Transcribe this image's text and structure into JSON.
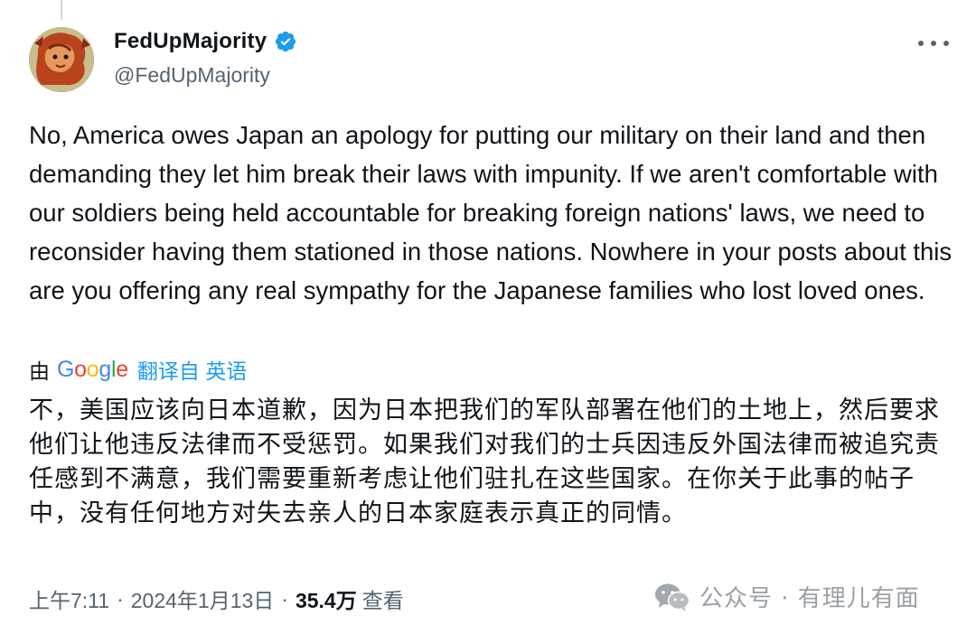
{
  "tweet": {
    "author": {
      "display_name": "FedUpMajority",
      "handle": "@FedUpMajority",
      "verified": true
    },
    "text": "No, America owes Japan an apology for putting our military on their land and then demanding they let him break their laws with impunity. If we aren't comfortable with our soldiers being held accountable for breaking foreign nations' laws, we need to reconsider having them stationed in those nations. Nowhere in your posts about this are you offering any real sympathy for the Japanese families who lost loved ones.",
    "translation": {
      "by_label": "由",
      "provider": "Google",
      "link_label": "翻译自 英语",
      "text": "不，美国应该向日本道歉，因为日本把我们的军队部署在他们的土地上，然后要求他们让他违反法律而不受惩罚。如果我们对我们的士兵因违反外国法律而被追究责任感到不满意，我们需要重新考虑让他们驻扎在这些国家。在你关于此事的帖子中，没有任何地方对失去亲人的日本家庭表示真正的同情。"
    },
    "meta": {
      "time": "上午7:11",
      "separator": "·",
      "date": "2024年1月13日",
      "views": "35.4万",
      "views_label": "查看"
    }
  },
  "watermark": {
    "text": "公众号 · 有理儿有面"
  },
  "colors": {
    "verified": "#1d9bf0",
    "link": "#1d9bf0",
    "secondary_text": "#536471",
    "primary_text": "#0f1419",
    "watermark": "#9aa0a6"
  },
  "icons": {
    "verified": "verified-badge-icon",
    "more": "more-horizontal-icon",
    "watermark": "wechat-icon"
  }
}
